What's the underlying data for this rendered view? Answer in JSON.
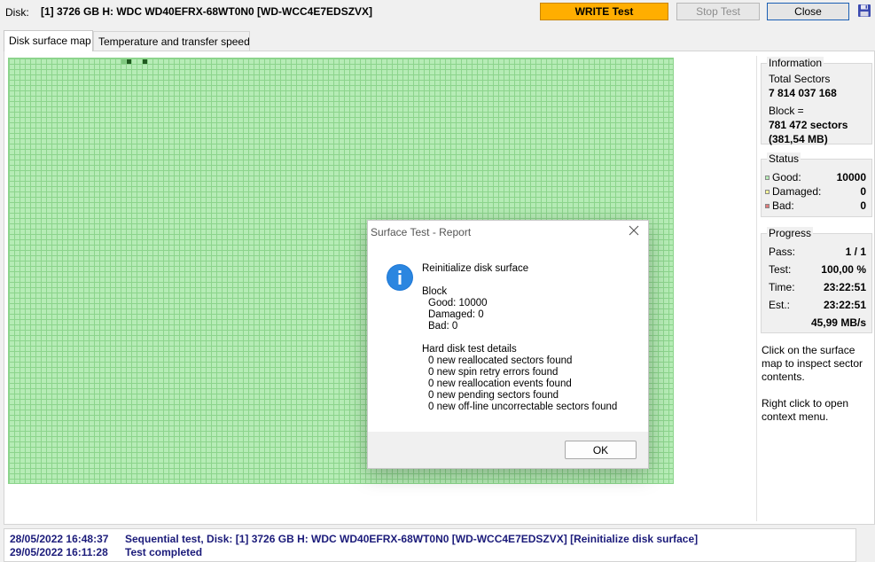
{
  "header": {
    "disk_label": "Disk:",
    "disk_value": "[1] 3726 GB H: WDC WD40EFRX-68WT0N0 [WD-WCC4E7EDSZVX]",
    "write_button": "WRITE Test",
    "stop_button": "Stop Test",
    "close_button": "Close",
    "save_icon": "floppy-disk-icon"
  },
  "tabs": [
    {
      "label": "Disk surface map",
      "active": true
    },
    {
      "label": "Temperature and transfer speed",
      "active": false
    }
  ],
  "colors": {
    "good": "#b6ecb6",
    "damaged": "#f5f59a",
    "bad": "#e07a7a",
    "write_button": "#ffae00",
    "log_text": "#1b1b7a"
  },
  "information": {
    "title": "Information",
    "total_sectors_label": "Total Sectors",
    "total_sectors_value": "7 814 037 168",
    "block_label": "Block =",
    "block_value_sectors": "781 472 sectors",
    "block_value_size": "(381,54 MB)"
  },
  "status": {
    "title": "Status",
    "good_label": "Good:",
    "good_value": "10000",
    "damaged_label": "Damaged:",
    "damaged_value": "0",
    "bad_label": "Bad:",
    "bad_value": "0"
  },
  "progress": {
    "title": "Progress",
    "pass_label": "Pass:",
    "pass_value": "1 / 1",
    "test_label": "Test:",
    "test_value": "100,00 %",
    "time_label": "Time:",
    "time_value": "23:22:51",
    "est_label": "Est.:",
    "est_value": "23:22:51",
    "speed_value": "45,99 MB/s"
  },
  "hints": {
    "inspect": "Click on the surface map to inspect sector contents.",
    "context": "Right click to open context menu."
  },
  "log": [
    {
      "date": "28/05/2022  16:48:37",
      "message": "Sequential test, Disk: [1] 3726 GB H: WDC WD40EFRX-68WT0N0 [WD-WCC4E7EDSZVX] [Reinitialize disk surface]"
    },
    {
      "date": "29/05/2022  16:11:28",
      "message": "Test completed"
    }
  ],
  "dialog": {
    "title": "Surface Test - Report",
    "icon": "info-icon",
    "heading": "Reinitialize disk surface",
    "block_title": "Block",
    "block_good": "Good: 10000",
    "block_damaged": "Damaged: 0",
    "block_bad": "Bad: 0",
    "details_title": "Hard disk test details",
    "details": [
      "0 new reallocated sectors found",
      "0 new spin retry errors found",
      "0 new reallocation events found",
      "0 new pending sectors found",
      "0 new off-line uncorrectable sectors found"
    ],
    "ok_button": "OK"
  }
}
